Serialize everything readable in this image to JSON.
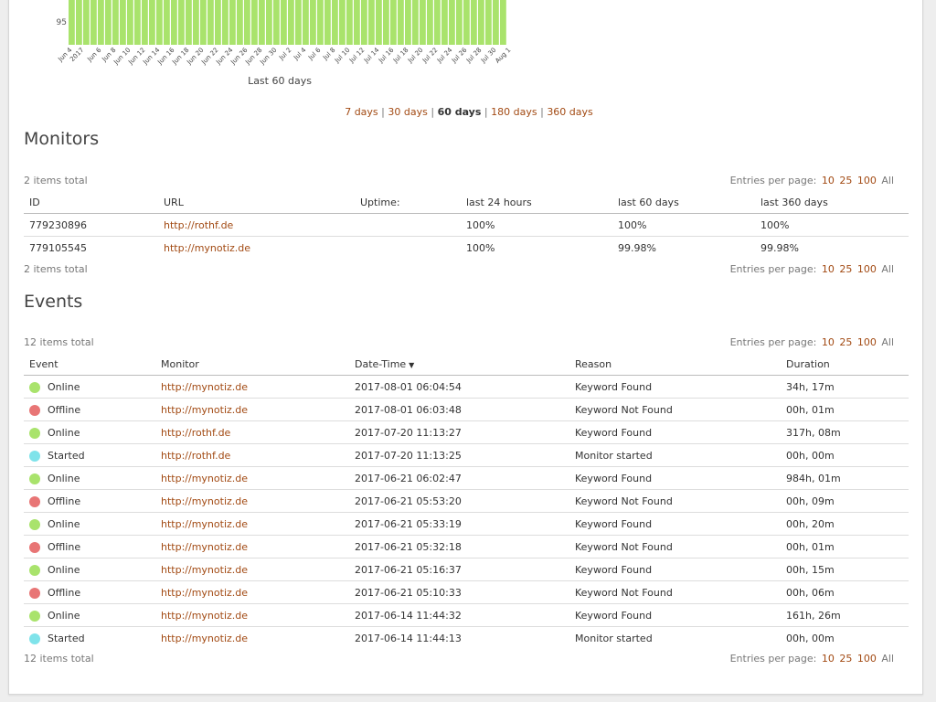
{
  "chart_data": {
    "type": "bar",
    "xlabel": "Last 60 days",
    "ylabel": "",
    "y_tick_visible": "95",
    "bar_value_display": "100",
    "x_tick_labels": [
      "Jun 4",
      "2017",
      "Jun 6",
      "Jun 8",
      "Jun 10",
      "Jun 12",
      "Jun 14",
      "Jun 16",
      "Jun 18",
      "Jun 20",
      "Jun 22",
      "Jun 24",
      "Jun 26",
      "Jun 28",
      "Jun 30",
      "Jul 2",
      "Jul 4",
      "Jul 6",
      "Jul 8",
      "Jul 10",
      "Jul 12",
      "Jul 14",
      "Jul 16",
      "Jul 18",
      "Jul 20",
      "Jul 22",
      "Jul 24",
      "Jul 26",
      "Jul 28",
      "Jul 30",
      "Aug 1"
    ],
    "values": [
      100,
      100,
      100,
      100,
      100,
      100,
      100,
      100,
      100,
      100,
      100,
      100,
      100,
      100,
      100,
      100,
      100,
      100,
      100,
      100,
      100,
      100,
      100,
      100,
      100,
      100,
      100,
      100,
      100,
      100,
      100,
      100,
      100,
      100,
      100,
      100,
      100,
      100,
      100,
      100,
      100,
      100,
      100,
      100,
      100,
      100,
      100,
      100,
      100,
      100,
      100,
      100,
      100,
      100,
      100,
      100,
      100,
      100,
      100,
      100
    ],
    "color": "#a9e36c"
  },
  "range_selector": {
    "options": [
      "7 days",
      "30 days",
      "60 days",
      "180 days",
      "360 days"
    ],
    "active": "60 days",
    "separator": "|"
  },
  "monitors": {
    "title": "Monitors",
    "items_total": "2 items total",
    "entries_label": "Entries per page:",
    "entries_options": [
      "10",
      "25",
      "100"
    ],
    "entries_all": "All",
    "columns": [
      "ID",
      "URL",
      "Uptime:",
      "last 24 hours",
      "last 60 days",
      "last 360 days"
    ],
    "rows": [
      {
        "id": "779230896",
        "url": "http://rothf.de",
        "uptime": "",
        "h24": "100%",
        "d60": "100%",
        "d360": "100%"
      },
      {
        "id": "779105545",
        "url": "http://mynotiz.de",
        "uptime": "",
        "h24": "100%",
        "d60": "99.98%",
        "d360": "99.98%"
      }
    ]
  },
  "events": {
    "title": "Events",
    "items_total": "12 items total",
    "entries_label": "Entries per page:",
    "entries_options": [
      "10",
      "25",
      "100"
    ],
    "entries_all": "All",
    "columns": [
      "Event",
      "Monitor",
      "Date-Time",
      "Reason",
      "Duration"
    ],
    "sort_icon": "chevron-down-icon",
    "status_colors": {
      "Online": "#a9e36c",
      "Offline": "#e87575",
      "Started": "#7fe3ea"
    },
    "rows": [
      {
        "event": "Online",
        "monitor": "http://mynotiz.de",
        "datetime": "2017-08-01 06:04:54",
        "reason": "Keyword Found",
        "duration": "34h, 17m"
      },
      {
        "event": "Offline",
        "monitor": "http://mynotiz.de",
        "datetime": "2017-08-01 06:03:48",
        "reason": "Keyword Not Found",
        "duration": "00h, 01m"
      },
      {
        "event": "Online",
        "monitor": "http://rothf.de",
        "datetime": "2017-07-20 11:13:27",
        "reason": "Keyword Found",
        "duration": "317h, 08m"
      },
      {
        "event": "Started",
        "monitor": "http://rothf.de",
        "datetime": "2017-07-20 11:13:25",
        "reason": "Monitor started",
        "duration": "00h, 00m"
      },
      {
        "event": "Online",
        "monitor": "http://mynotiz.de",
        "datetime": "2017-06-21 06:02:47",
        "reason": "Keyword Found",
        "duration": "984h, 01m"
      },
      {
        "event": "Offline",
        "monitor": "http://mynotiz.de",
        "datetime": "2017-06-21 05:53:20",
        "reason": "Keyword Not Found",
        "duration": "00h, 09m"
      },
      {
        "event": "Online",
        "monitor": "http://mynotiz.de",
        "datetime": "2017-06-21 05:33:19",
        "reason": "Keyword Found",
        "duration": "00h, 20m"
      },
      {
        "event": "Offline",
        "monitor": "http://mynotiz.de",
        "datetime": "2017-06-21 05:32:18",
        "reason": "Keyword Not Found",
        "duration": "00h, 01m"
      },
      {
        "event": "Online",
        "monitor": "http://mynotiz.de",
        "datetime": "2017-06-21 05:16:37",
        "reason": "Keyword Found",
        "duration": "00h, 15m"
      },
      {
        "event": "Offline",
        "monitor": "http://mynotiz.de",
        "datetime": "2017-06-21 05:10:33",
        "reason": "Keyword Not Found",
        "duration": "00h, 06m"
      },
      {
        "event": "Online",
        "monitor": "http://mynotiz.de",
        "datetime": "2017-06-14 11:44:32",
        "reason": "Keyword Found",
        "duration": "161h, 26m"
      },
      {
        "event": "Started",
        "monitor": "http://mynotiz.de",
        "datetime": "2017-06-14 11:44:13",
        "reason": "Monitor started",
        "duration": "00h, 00m"
      }
    ]
  }
}
